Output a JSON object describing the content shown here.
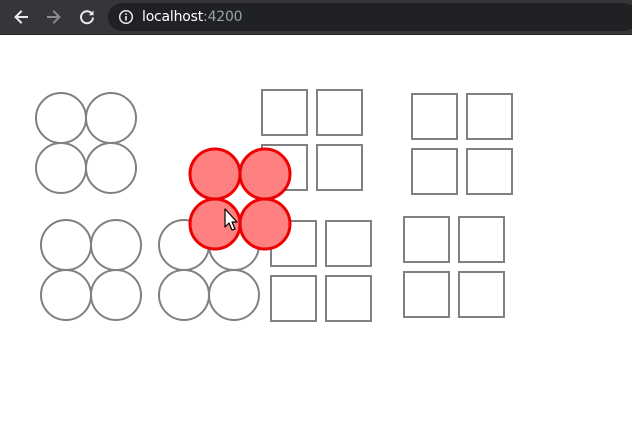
{
  "browser": {
    "url_host": "localhost",
    "url_port": ":4200",
    "back_icon": "arrow-left-icon",
    "forward_icon": "arrow-right-icon",
    "reload_icon": "reload-icon",
    "info_icon": "info-icon"
  },
  "colors": {
    "toolbar": "#35363a",
    "omnibox": "#202124",
    "shape_stroke": "#808080",
    "selected_fill": "#ff8080",
    "selected_stroke": "#ee0000"
  },
  "scene": {
    "groups": [
      {
        "type": "circles",
        "selected": false
      },
      {
        "type": "squares",
        "selected": false
      },
      {
        "type": "squares",
        "selected": false
      },
      {
        "type": "circles",
        "selected": false
      },
      {
        "type": "circles",
        "selected": false
      },
      {
        "type": "squares",
        "selected": false
      },
      {
        "type": "squares",
        "selected": false
      },
      {
        "type": "circles",
        "selected": true
      }
    ],
    "cursor": "arrow-cursor-icon"
  }
}
